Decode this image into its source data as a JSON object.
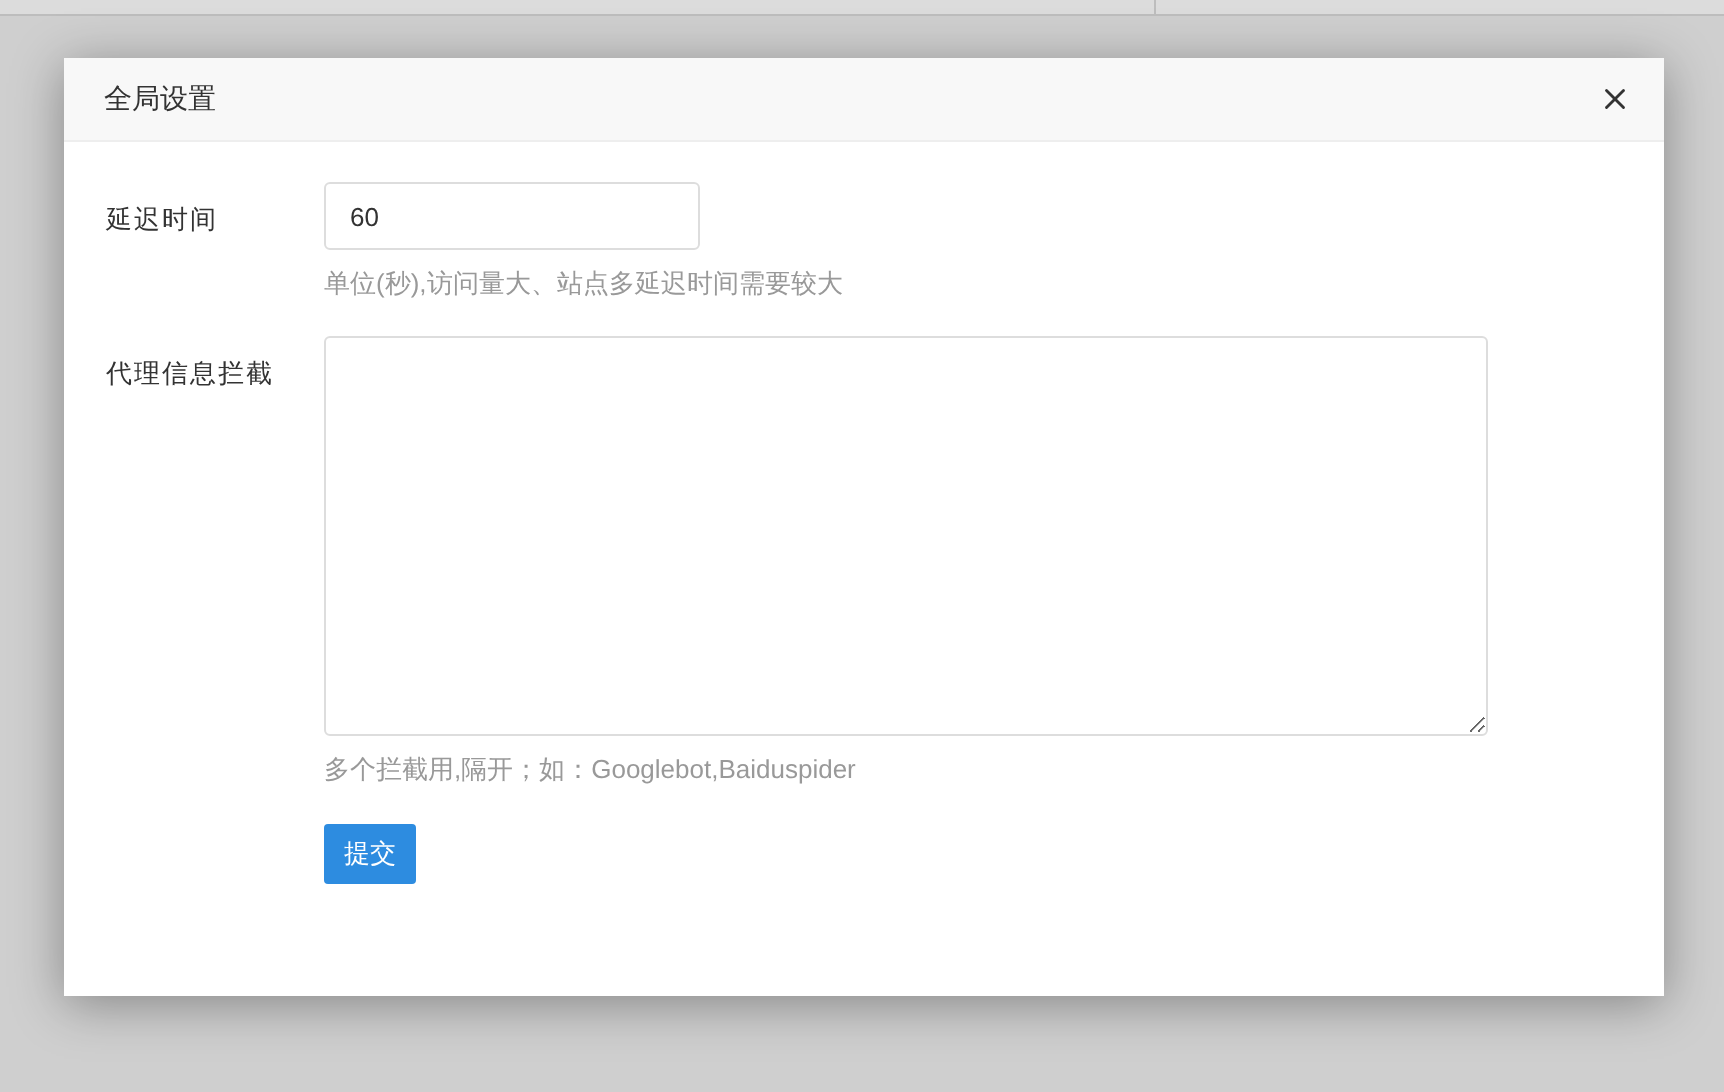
{
  "dialog": {
    "title": "全局设置",
    "fields": [
      {
        "kind": "input",
        "label": "延迟时间",
        "value": "60",
        "help": "单位(秒),访问量大、站点多延迟时间需要较大"
      },
      {
        "kind": "textarea",
        "label": "代理信息拦截",
        "help": "多个拦截用,隔开；如：Googlebot,Baiduspider"
      }
    ],
    "submit": "提交"
  }
}
